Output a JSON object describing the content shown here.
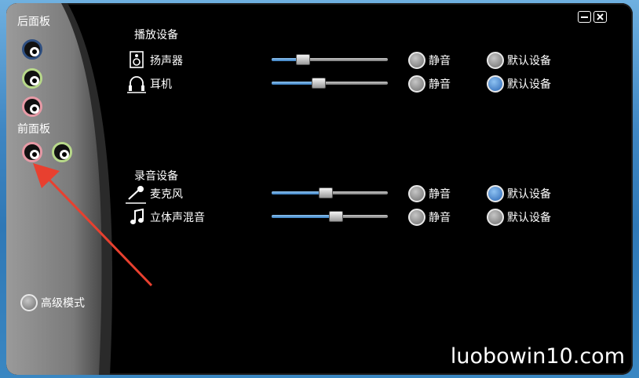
{
  "window": {
    "minimize_label": "—",
    "close_label": "×"
  },
  "sidebar": {
    "rear_panel_label": "后面板",
    "front_panel_label": "前面板",
    "advanced_label": "高级模式",
    "rear_jacks": [
      {
        "color": "#2f4f80"
      },
      {
        "color": "#b8d98a"
      },
      {
        "color": "#e79aa6"
      }
    ],
    "front_jacks": [
      {
        "color": "#e79aa6"
      },
      {
        "color": "#b8d98a"
      }
    ]
  },
  "playback": {
    "section_label": "播放设备",
    "devices": [
      {
        "name": "扬声器",
        "icon": "speaker-icon",
        "volume": 0.24,
        "mute_label": "静音",
        "default_label": "默认设备",
        "is_default": false
      },
      {
        "name": "耳机",
        "icon": "headphones-icon",
        "volume": 0.39,
        "mute_label": "静音",
        "default_label": "默认设备",
        "is_default": true
      }
    ]
  },
  "recording": {
    "section_label": "录音设备",
    "devices": [
      {
        "name": "麦克风",
        "icon": "microphone-icon",
        "volume": 0.46,
        "mute_label": "静音",
        "default_label": "默认设备",
        "is_default": true
      },
      {
        "name": "立体声混音",
        "icon": "music-note-icon",
        "volume": 0.56,
        "mute_label": "静音",
        "default_label": "默认设备",
        "is_default": false
      }
    ]
  },
  "watermark": "luobowin10.com",
  "colors": {
    "accent_blue": "#2a66b4",
    "arrow_red": "#e8402f",
    "sidebar_gray": "#8a8a8a"
  }
}
